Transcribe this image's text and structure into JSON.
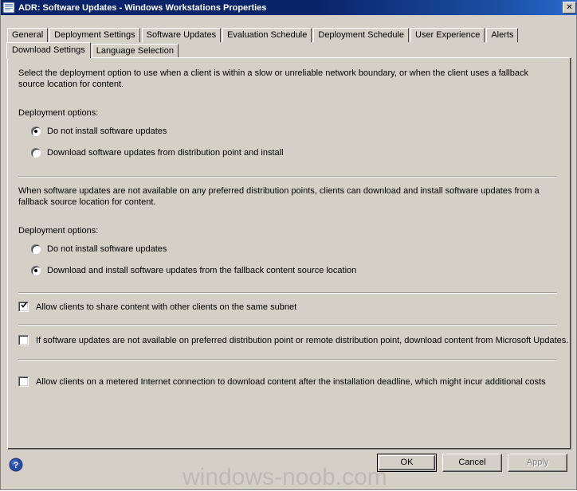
{
  "window": {
    "title": "ADR: Software Updates - Windows Workstations Properties",
    "title_icon": "properties-document-icon",
    "close_button_label": "✕",
    "titlebar_color": "#0a246a",
    "face_color": "#d4d0c8"
  },
  "tabs": {
    "row1": [
      {
        "label": "General",
        "selected": false
      },
      {
        "label": "Deployment Settings",
        "selected": false
      },
      {
        "label": "Software Updates",
        "selected": false
      },
      {
        "label": "Evaluation Schedule",
        "selected": false
      },
      {
        "label": "Deployment Schedule",
        "selected": false
      },
      {
        "label": "User Experience",
        "selected": false
      },
      {
        "label": "Alerts",
        "selected": false
      }
    ],
    "row2": [
      {
        "label": "Download Settings",
        "selected": true
      },
      {
        "label": "Language Selection",
        "selected": false
      }
    ]
  },
  "panel": {
    "intro_text": "Select the deployment option to use when a client is within a slow or unreliable network boundary, or when the client uses a fallback source location for content.",
    "group1": {
      "label": "Deployment options:",
      "options": [
        {
          "label": "Do not install software updates",
          "selected": true
        },
        {
          "label": "Download software updates from distribution point and install",
          "selected": false
        }
      ]
    },
    "fallback_text": "When software updates are not available on any preferred distribution points, clients can download and install software updates from a fallback source location for content.",
    "group2": {
      "label": "Deployment options:",
      "options": [
        {
          "label": "Do not install software updates",
          "selected": false
        },
        {
          "label": "Download and install software updates from the fallback content source location",
          "selected": true
        }
      ]
    },
    "checkboxes": [
      {
        "label": "Allow clients to share content with other clients on the same subnet",
        "checked": true
      },
      {
        "label": "If software updates are not available on preferred distribution point or remote distribution point, download content from Microsoft Updates.",
        "checked": false
      },
      {
        "label": "Allow clients on a metered Internet connection to download content after the installation deadline, which might incur additional costs",
        "checked": false
      }
    ]
  },
  "footer": {
    "help_icon": "help-question-icon",
    "ok_label": "OK",
    "cancel_label": "Cancel",
    "apply_label": "Apply",
    "apply_enabled": false
  },
  "watermark": {
    "text": "windows-noob.com",
    "color": "#bdbab3"
  }
}
